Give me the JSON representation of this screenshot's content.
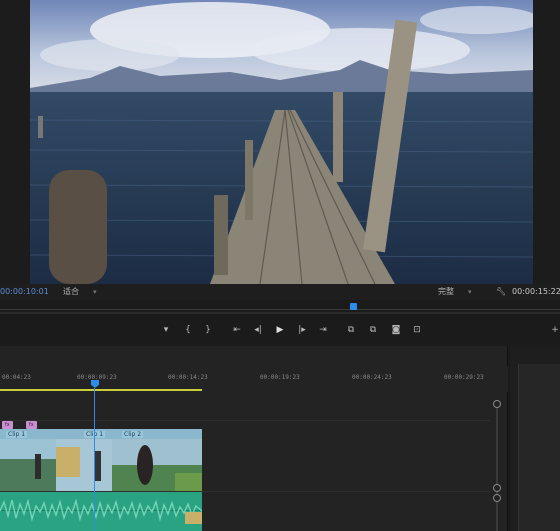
{
  "program_monitor": {
    "current_timecode": "00:00:10:01",
    "fit_label": "适合",
    "quality_label": "完整",
    "duration_timecode": "00:00:15:22"
  },
  "transport": {
    "buttons": [
      {
        "name": "add-marker-button",
        "glyph": "▾"
      },
      {
        "name": "mark-in-button",
        "glyph": "{"
      },
      {
        "name": "mark-out-button",
        "glyph": "}"
      },
      {
        "name": "go-to-in-button",
        "glyph": "⇤"
      },
      {
        "name": "step-back-button",
        "glyph": "◂|"
      },
      {
        "name": "play-button",
        "glyph": "▶"
      },
      {
        "name": "step-forward-button",
        "glyph": "|▸"
      },
      {
        "name": "go-to-out-button",
        "glyph": "⇥"
      },
      {
        "name": "lift-button",
        "glyph": "⧉"
      },
      {
        "name": "extract-button",
        "glyph": "⧉"
      },
      {
        "name": "export-frame-button",
        "glyph": "◙"
      },
      {
        "name": "compare-view-button",
        "glyph": "⊡"
      }
    ]
  },
  "timeline": {
    "ruler_ticks": [
      "00:04:23",
      "00:00:09:23",
      "00:00:14:23",
      "00:00:19:23",
      "00:00:24:23",
      "00:00:29:23"
    ],
    "fx_badges": [
      "fx",
      "fx"
    ],
    "clip_labels": [
      "Clip 1",
      "Clip 1",
      "Clip 2"
    ]
  },
  "colors": {
    "timecode_blue": "#2d8ceb",
    "work_area_yellow": "#c9cf3a",
    "video_clip": "#7db0c9",
    "audio_clip": "#2aa383",
    "fx_badge": "#c98fd1"
  }
}
